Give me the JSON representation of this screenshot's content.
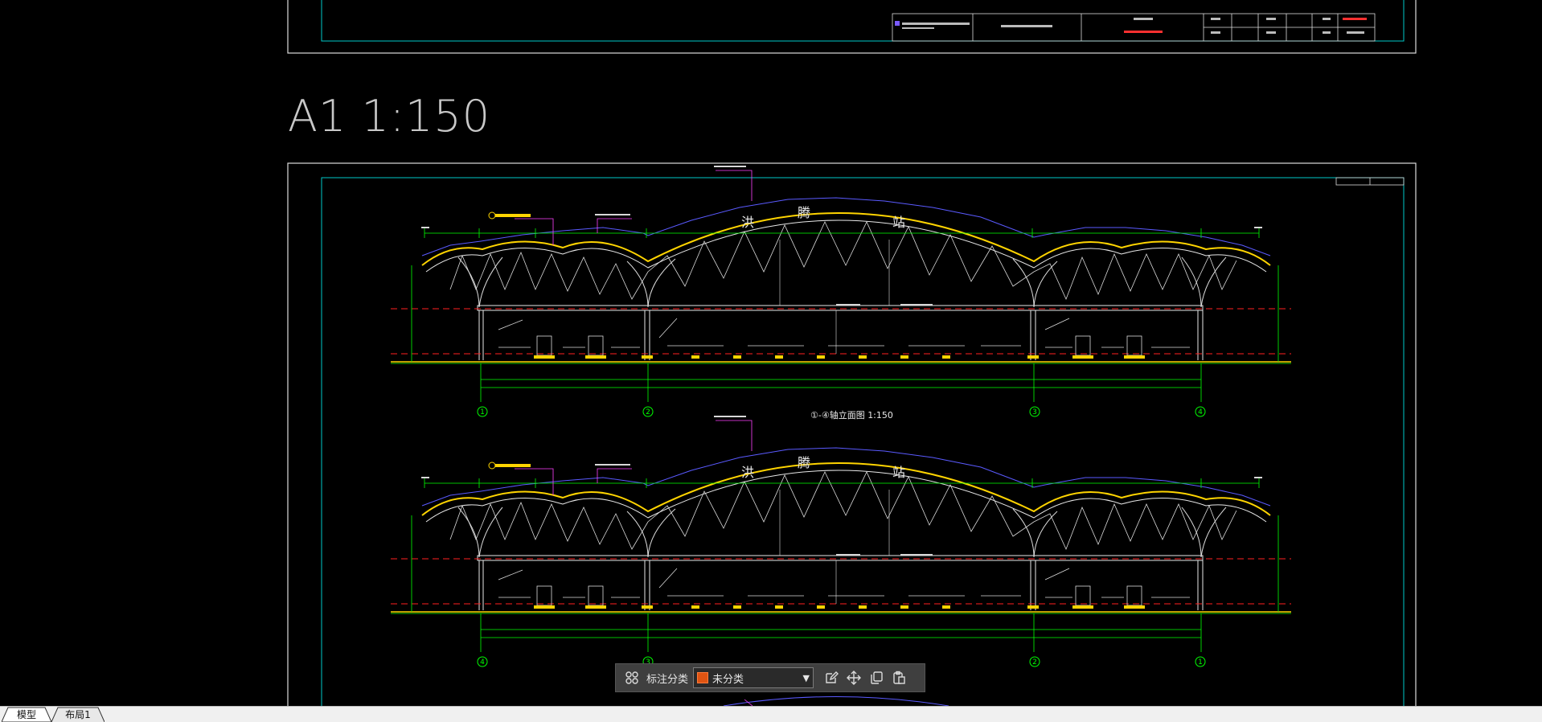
{
  "drawing": {
    "scale_label": "A1 1:150",
    "station_chars": [
      "洪",
      "腾",
      "站"
    ],
    "elevation_caption_1": "①-④轴立面图 1:150",
    "axis_labels_top": [
      "1",
      "2",
      "3",
      "4"
    ],
    "axis_labels_bottom": [
      "4",
      "3",
      "2",
      "1"
    ]
  },
  "toolbar": {
    "category_label": "标注分类",
    "category_value": "未分类",
    "swatch_color": "#e05412",
    "icons": [
      "grid-icon",
      "edit-icon",
      "move-icon",
      "copy-icon",
      "paste-icon"
    ]
  },
  "tabs": [
    {
      "label": "模型",
      "active": true
    },
    {
      "label": "布局1",
      "active": false
    }
  ],
  "colors": {
    "background": "#000000",
    "frame": "#ffffff",
    "inner_frame": "#00c8c8",
    "dimension": "#00ff00",
    "structure": "#ffffff",
    "roof": "#ffd400",
    "outline": "#5a5aff",
    "level": "#ff2020"
  }
}
